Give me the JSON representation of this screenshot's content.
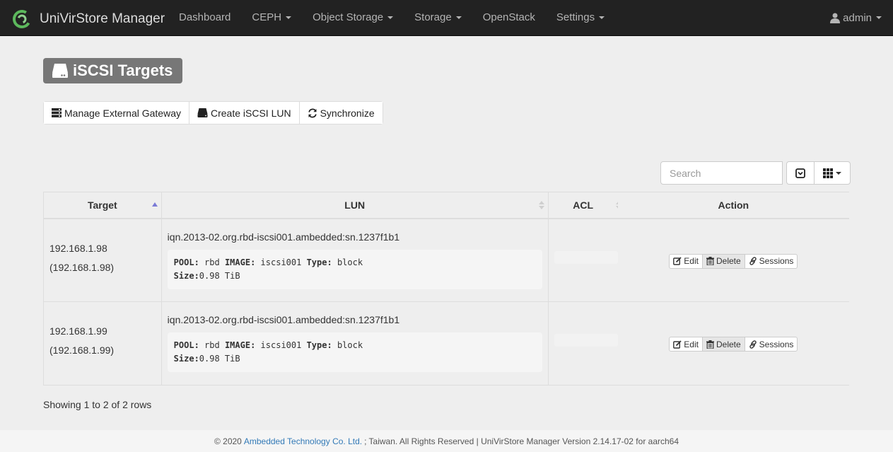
{
  "brand": {
    "name": "UniVirStore Manager"
  },
  "nav": {
    "items": [
      {
        "label": "Dashboard",
        "dropdown": false
      },
      {
        "label": "CEPH",
        "dropdown": true
      },
      {
        "label": "Object Storage",
        "dropdown": true
      },
      {
        "label": "Storage",
        "dropdown": true
      },
      {
        "label": "OpenStack",
        "dropdown": false
      },
      {
        "label": "Settings",
        "dropdown": true
      }
    ],
    "user": "admin"
  },
  "page": {
    "title": "iSCSI Targets"
  },
  "toolbar": {
    "manage_gateway": "Manage External Gateway",
    "create_lun": "Create iSCSI LUN",
    "synchronize": "Synchronize"
  },
  "search": {
    "placeholder": "Search"
  },
  "table": {
    "columns": [
      "Target",
      "LUN",
      "ACL",
      "Action"
    ],
    "rows": [
      {
        "target": "192.168.1.98",
        "target_paren": "(192.168.1.98)",
        "iqn": "iqn.2013-02.org.rbd-iscsi001.ambedded:sn.1237f1b1",
        "pool_label": "POOL:",
        "pool": "rbd",
        "image_label": "IMAGE:",
        "image": "iscsi001",
        "type_label": "Type:",
        "type": "block",
        "size_label": "Size:",
        "size": "0.98 TiB"
      },
      {
        "target": "192.168.1.99",
        "target_paren": "(192.168.1.99)",
        "iqn": "iqn.2013-02.org.rbd-iscsi001.ambedded:sn.1237f1b1",
        "pool_label": "POOL:",
        "pool": "rbd",
        "image_label": "IMAGE:",
        "image": "iscsi001",
        "type_label": "Type:",
        "type": "block",
        "size_label": "Size:",
        "size": "0.98 TiB"
      }
    ],
    "actions": {
      "edit": "Edit",
      "delete": "Delete",
      "sessions": "Sessions"
    }
  },
  "pagination": {
    "info": "Showing 1 to 2 of 2 rows"
  },
  "footer": {
    "prefix": "© 2020",
    "company": "Ambedded Technology Co. Ltd.",
    "suffix": "; Taiwan. All Rights Reserved | UniVirStore Manager Version 2.14.17-02 for aarch64"
  },
  "colors": {
    "navbar": "#222222",
    "link": "#337ab7",
    "title_bg": "#777777"
  }
}
